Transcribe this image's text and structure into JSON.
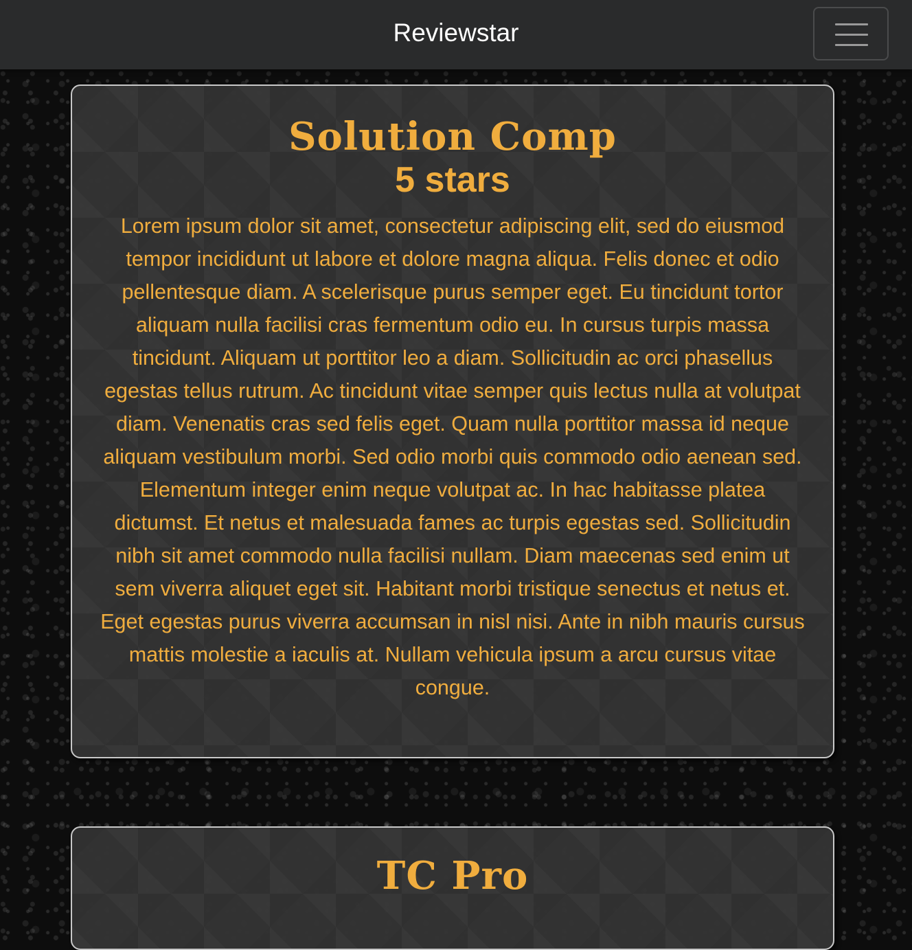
{
  "navbar": {
    "brand": "Reviewstar",
    "toggle_icon": "hamburger-menu-icon"
  },
  "reviews": [
    {
      "title": "Solution Comp",
      "rating": "5 stars",
      "body": "Lorem ipsum dolor sit amet, consectetur adipiscing elit, sed do eiusmod tempor incididunt ut labore et dolore magna aliqua. Felis donec et odio pellentesque diam. A scelerisque purus semper eget. Eu tincidunt tortor aliquam nulla facilisi cras fermentum odio eu. In cursus turpis massa tincidunt. Aliquam ut porttitor leo a diam. Sollicitudin ac orci phasellus egestas tellus rutrum. Ac tincidunt vitae semper quis lectus nulla at volutpat diam. Venenatis cras sed felis eget. Quam nulla porttitor massa id neque aliquam vestibulum morbi. Sed odio morbi quis commodo odio aenean sed. Elementum integer enim neque volutpat ac. In hac habitasse platea dictumst. Et netus et malesuada fames ac turpis egestas sed. Sollicitudin nibh sit amet commodo nulla facilisi nullam. Diam maecenas sed enim ut sem viverra aliquet eget sit. Habitant morbi tristique senectus et netus et. Eget egestas purus viverra accumsan in nisl nisi. Ante in nibh mauris cursus mattis molestie a iaculis at. Nullam vehicula ipsum a arcu cursus vitae congue."
    },
    {
      "title": "TC Pro"
    }
  ],
  "colors": {
    "accent": "#f0ad3e",
    "navbar_bg": "#2a2b2c",
    "card_border": "#c8c8c8"
  }
}
